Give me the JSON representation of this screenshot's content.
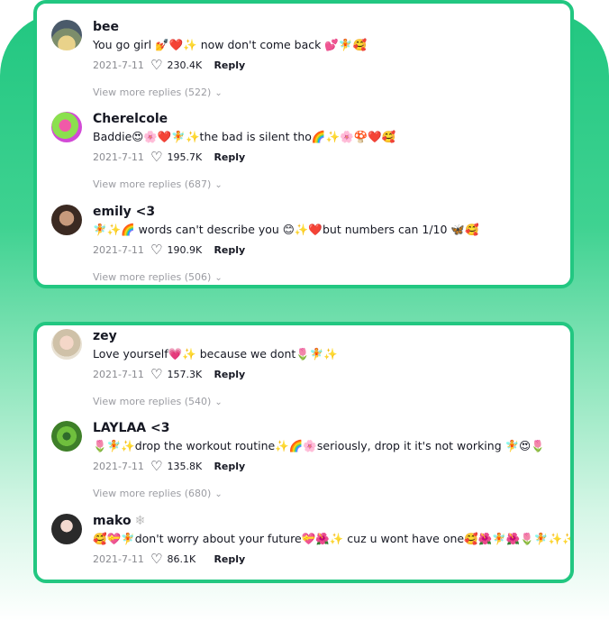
{
  "panel1": {
    "comments": [
      {
        "user": "bee",
        "badge": "",
        "text": "You go girl 💅❤️✨ now don't come back 💕🧚🥰",
        "date": "2021-7-11",
        "likes": "230.4K",
        "reply": "Reply",
        "more": "View more replies (522)"
      },
      {
        "user": "Cherelcole",
        "badge": "",
        "text": "Baddie😍🌸❤️🧚✨the bad is silent tho🌈✨🌸🍄❤️🥰",
        "date": "2021-7-11",
        "likes": "195.7K",
        "reply": "Reply",
        "more": "View more replies (687)"
      },
      {
        "user": "emily <3",
        "badge": "",
        "text": "🧚✨🌈 words can't describe you 😊✨❤️but numbers can 1/10 🦋🥰",
        "date": "2021-7-11",
        "likes": "190.9K",
        "reply": "Reply",
        "more": "View more replies (506)"
      }
    ]
  },
  "panel2": {
    "comments": [
      {
        "user": "zey",
        "badge": "",
        "text": "Love yourself💗✨ because we dont🌷🧚✨",
        "date": "2021-7-11",
        "likes": "157.3K",
        "reply": "Reply",
        "more": "View more replies (540)"
      },
      {
        "user": "LAYLAA <3",
        "badge": "",
        "text": "🌷🧚✨drop the workout routine✨🌈🌸seriously, drop it it's not working 🧚😍🌷",
        "date": "2021-7-11",
        "likes": "135.8K",
        "reply": "Reply",
        "more": "View more replies (680)"
      },
      {
        "user": "mako",
        "badge": "❄",
        "text": "🥰💝🧚don't worry about your future💝🌺✨ cuz u wont have one🥰🌺🧚🌺🌷🧚✨✨",
        "date": "2021-7-11",
        "likes": "86.1K",
        "reply": "Reply",
        "more": ""
      }
    ]
  },
  "icons": {
    "like": "heart-outline-icon",
    "expand": "chevron-down-icon"
  },
  "colors": {
    "accent": "#22c781",
    "text": "#161823",
    "muted": "#8a8b91"
  }
}
